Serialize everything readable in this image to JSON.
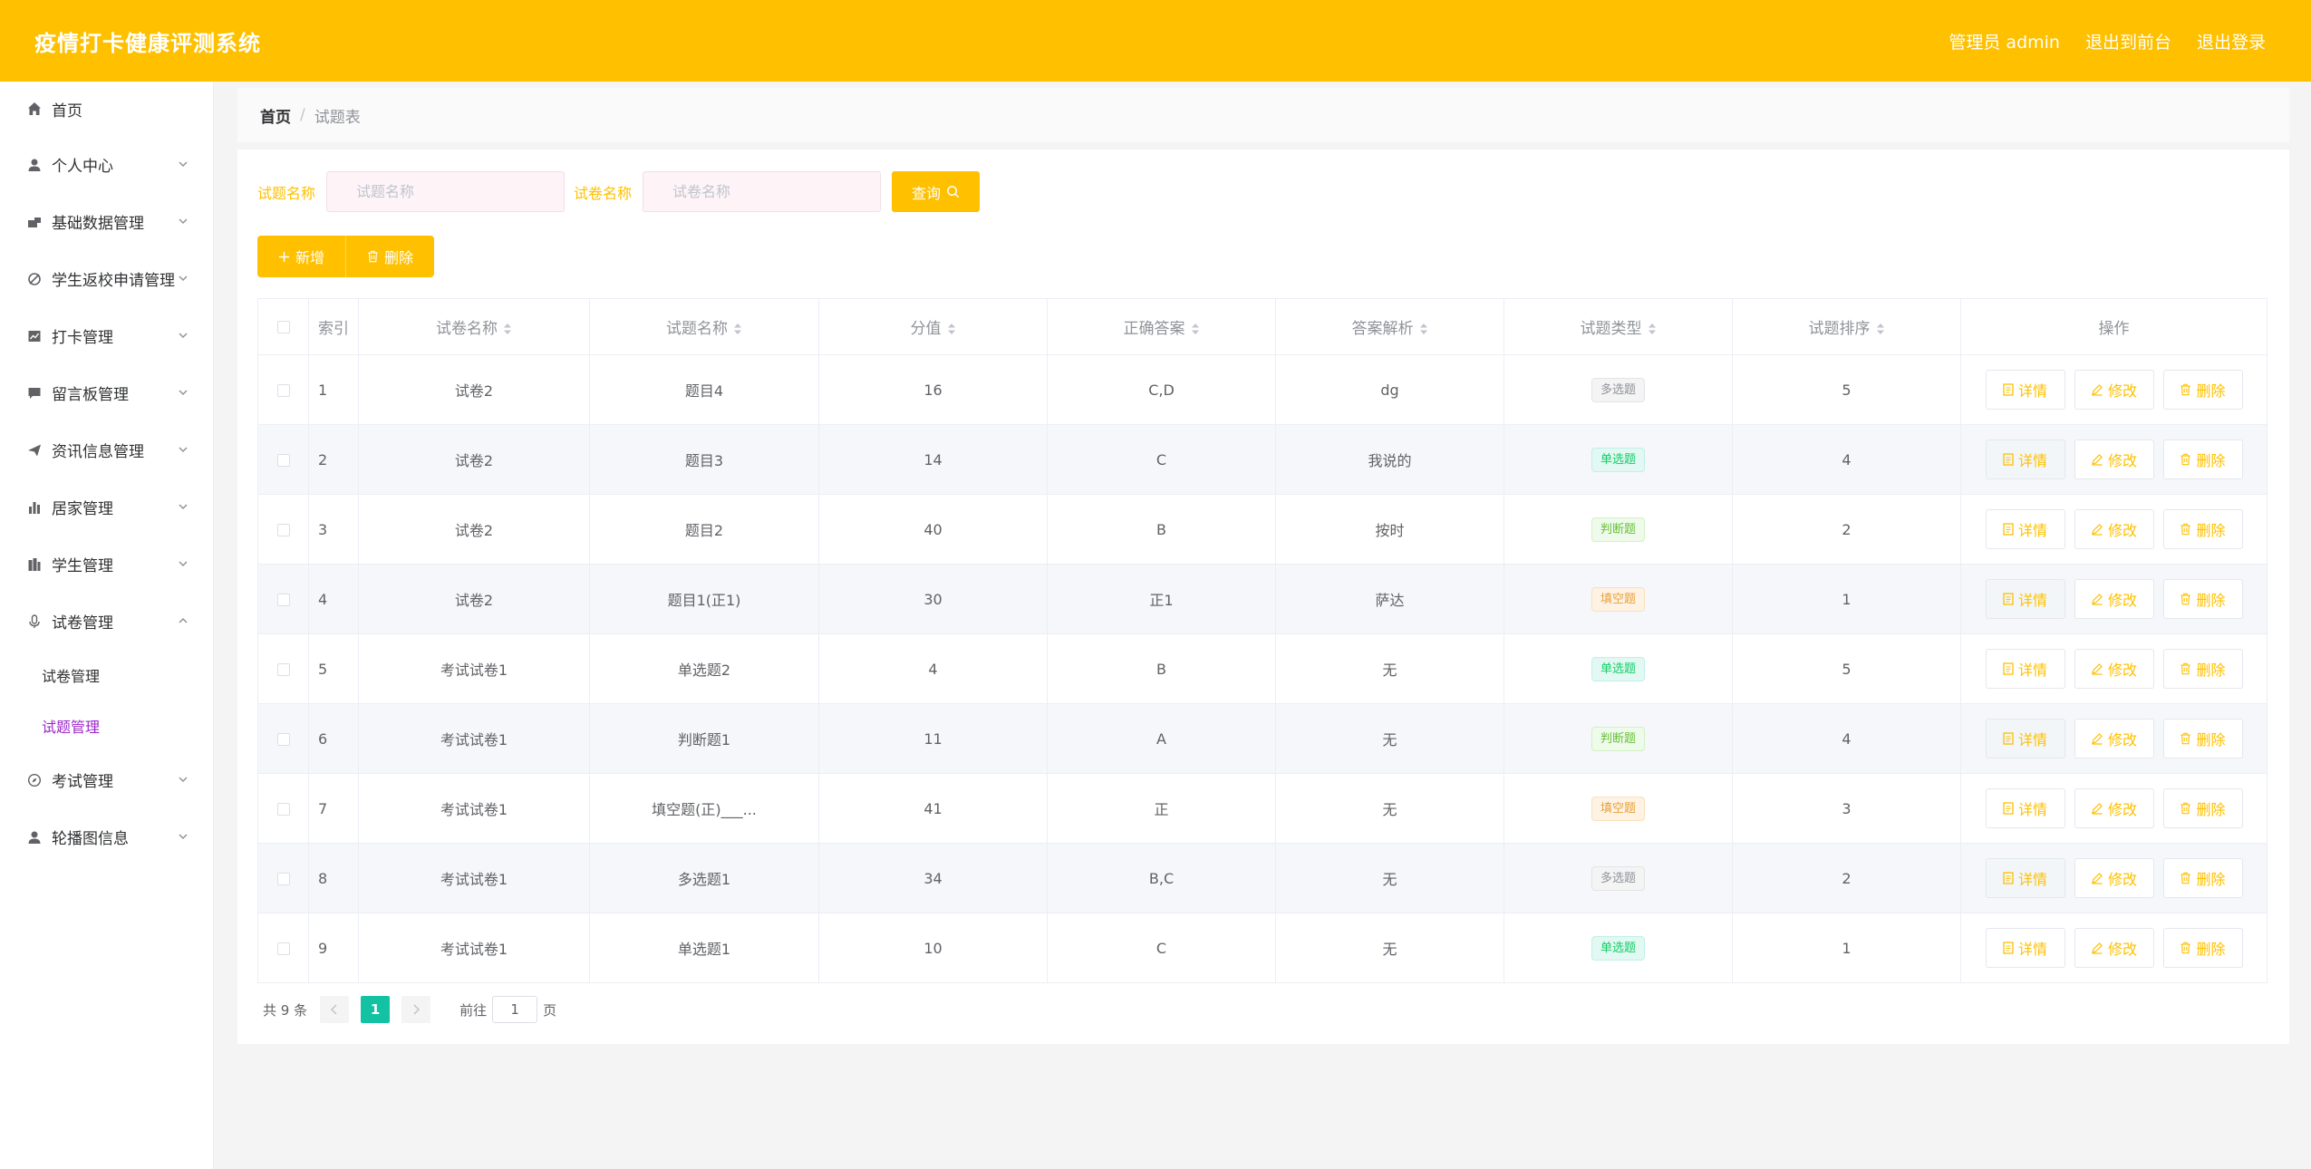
{
  "header": {
    "title": "疫情打卡健康评测系统",
    "user_label": "管理员 admin",
    "to_front": "退出到前台",
    "logout": "退出登录"
  },
  "sidebar": {
    "items": [
      {
        "label": "首页",
        "icon": "home-icon",
        "expandable": false
      },
      {
        "label": "个人中心",
        "icon": "user-icon",
        "expandable": true
      },
      {
        "label": "基础数据管理",
        "icon": "data-icon",
        "expandable": true
      },
      {
        "label": "学生返校申请管理",
        "icon": "no-entry-icon",
        "expandable": true
      },
      {
        "label": "打卡管理",
        "icon": "chart-icon",
        "expandable": true
      },
      {
        "label": "留言板管理",
        "icon": "message-icon",
        "expandable": true
      },
      {
        "label": "资讯信息管理",
        "icon": "send-icon",
        "expandable": true
      },
      {
        "label": "居家管理",
        "icon": "bar-icon",
        "expandable": true
      },
      {
        "label": "学生管理",
        "icon": "building-icon",
        "expandable": true
      },
      {
        "label": "试卷管理",
        "icon": "mic-icon",
        "expandable": true,
        "open": true,
        "children": [
          {
            "label": "试卷管理"
          },
          {
            "label": "试题管理",
            "active": true
          }
        ]
      },
      {
        "label": "考试管理",
        "icon": "compass-icon",
        "expandable": true
      },
      {
        "label": "轮播图信息",
        "icon": "user-icon",
        "expandable": true
      }
    ]
  },
  "breadcrumb": {
    "home": "首页",
    "separator": "/",
    "current": "试题表"
  },
  "search": {
    "question_label": "试题名称",
    "question_placeholder": "试题名称",
    "paper_label": "试卷名称",
    "paper_placeholder": "试卷名称",
    "query_button": "查询"
  },
  "actions": {
    "add": "新增",
    "delete": "删除"
  },
  "table": {
    "headers": [
      "索引",
      "试卷名称",
      "试题名称",
      "分值",
      "正确答案",
      "答案解析",
      "试题类型",
      "试题排序",
      "操作"
    ],
    "row_buttons": {
      "detail": "详情",
      "edit": "修改",
      "delete": "删除"
    },
    "rows": [
      {
        "idx": "1",
        "paper": "试卷2",
        "question": "题目4",
        "score": "16",
        "answer": "C,D",
        "analysis": "dg",
        "type": "多选题",
        "type_color": "gray",
        "order": "5"
      },
      {
        "idx": "2",
        "paper": "试卷2",
        "question": "题目3",
        "score": "14",
        "answer": "C",
        "analysis": "我说的",
        "type": "单选题",
        "type_color": "green",
        "order": "4"
      },
      {
        "idx": "3",
        "paper": "试卷2",
        "question": "题目2",
        "score": "40",
        "answer": "B",
        "analysis": "按时",
        "type": "判断题",
        "type_color": "lime",
        "order": "2"
      },
      {
        "idx": "4",
        "paper": "试卷2",
        "question": "题目1(正1)",
        "score": "30",
        "answer": "正1",
        "analysis": "萨达",
        "type": "填空题",
        "type_color": "orange",
        "order": "1"
      },
      {
        "idx": "5",
        "paper": "考试试卷1",
        "question": "单选题2",
        "score": "4",
        "answer": "B",
        "analysis": "无",
        "type": "单选题",
        "type_color": "green",
        "order": "5"
      },
      {
        "idx": "6",
        "paper": "考试试卷1",
        "question": "判断题1",
        "score": "11",
        "answer": "A",
        "analysis": "无",
        "type": "判断题",
        "type_color": "lime",
        "order": "4"
      },
      {
        "idx": "7",
        "paper": "考试试卷1",
        "question": "填空题(正)___...",
        "score": "41",
        "answer": "正",
        "analysis": "无",
        "type": "填空题",
        "type_color": "orange",
        "order": "3"
      },
      {
        "idx": "8",
        "paper": "考试试卷1",
        "question": "多选题1",
        "score": "34",
        "answer": "B,C",
        "analysis": "无",
        "type": "多选题",
        "type_color": "gray",
        "order": "2"
      },
      {
        "idx": "9",
        "paper": "考试试卷1",
        "question": "单选题1",
        "score": "10",
        "answer": "C",
        "analysis": "无",
        "type": "单选题",
        "type_color": "green",
        "order": "1"
      }
    ]
  },
  "pagination": {
    "total": "共 9 条",
    "current_page": "1",
    "goto_label": "前往",
    "goto_value": "1",
    "page_suffix": "页"
  },
  "colors": {
    "accent": "#ffc000",
    "active_menu": "#9b27c9",
    "page_active": "#13c2a3"
  }
}
